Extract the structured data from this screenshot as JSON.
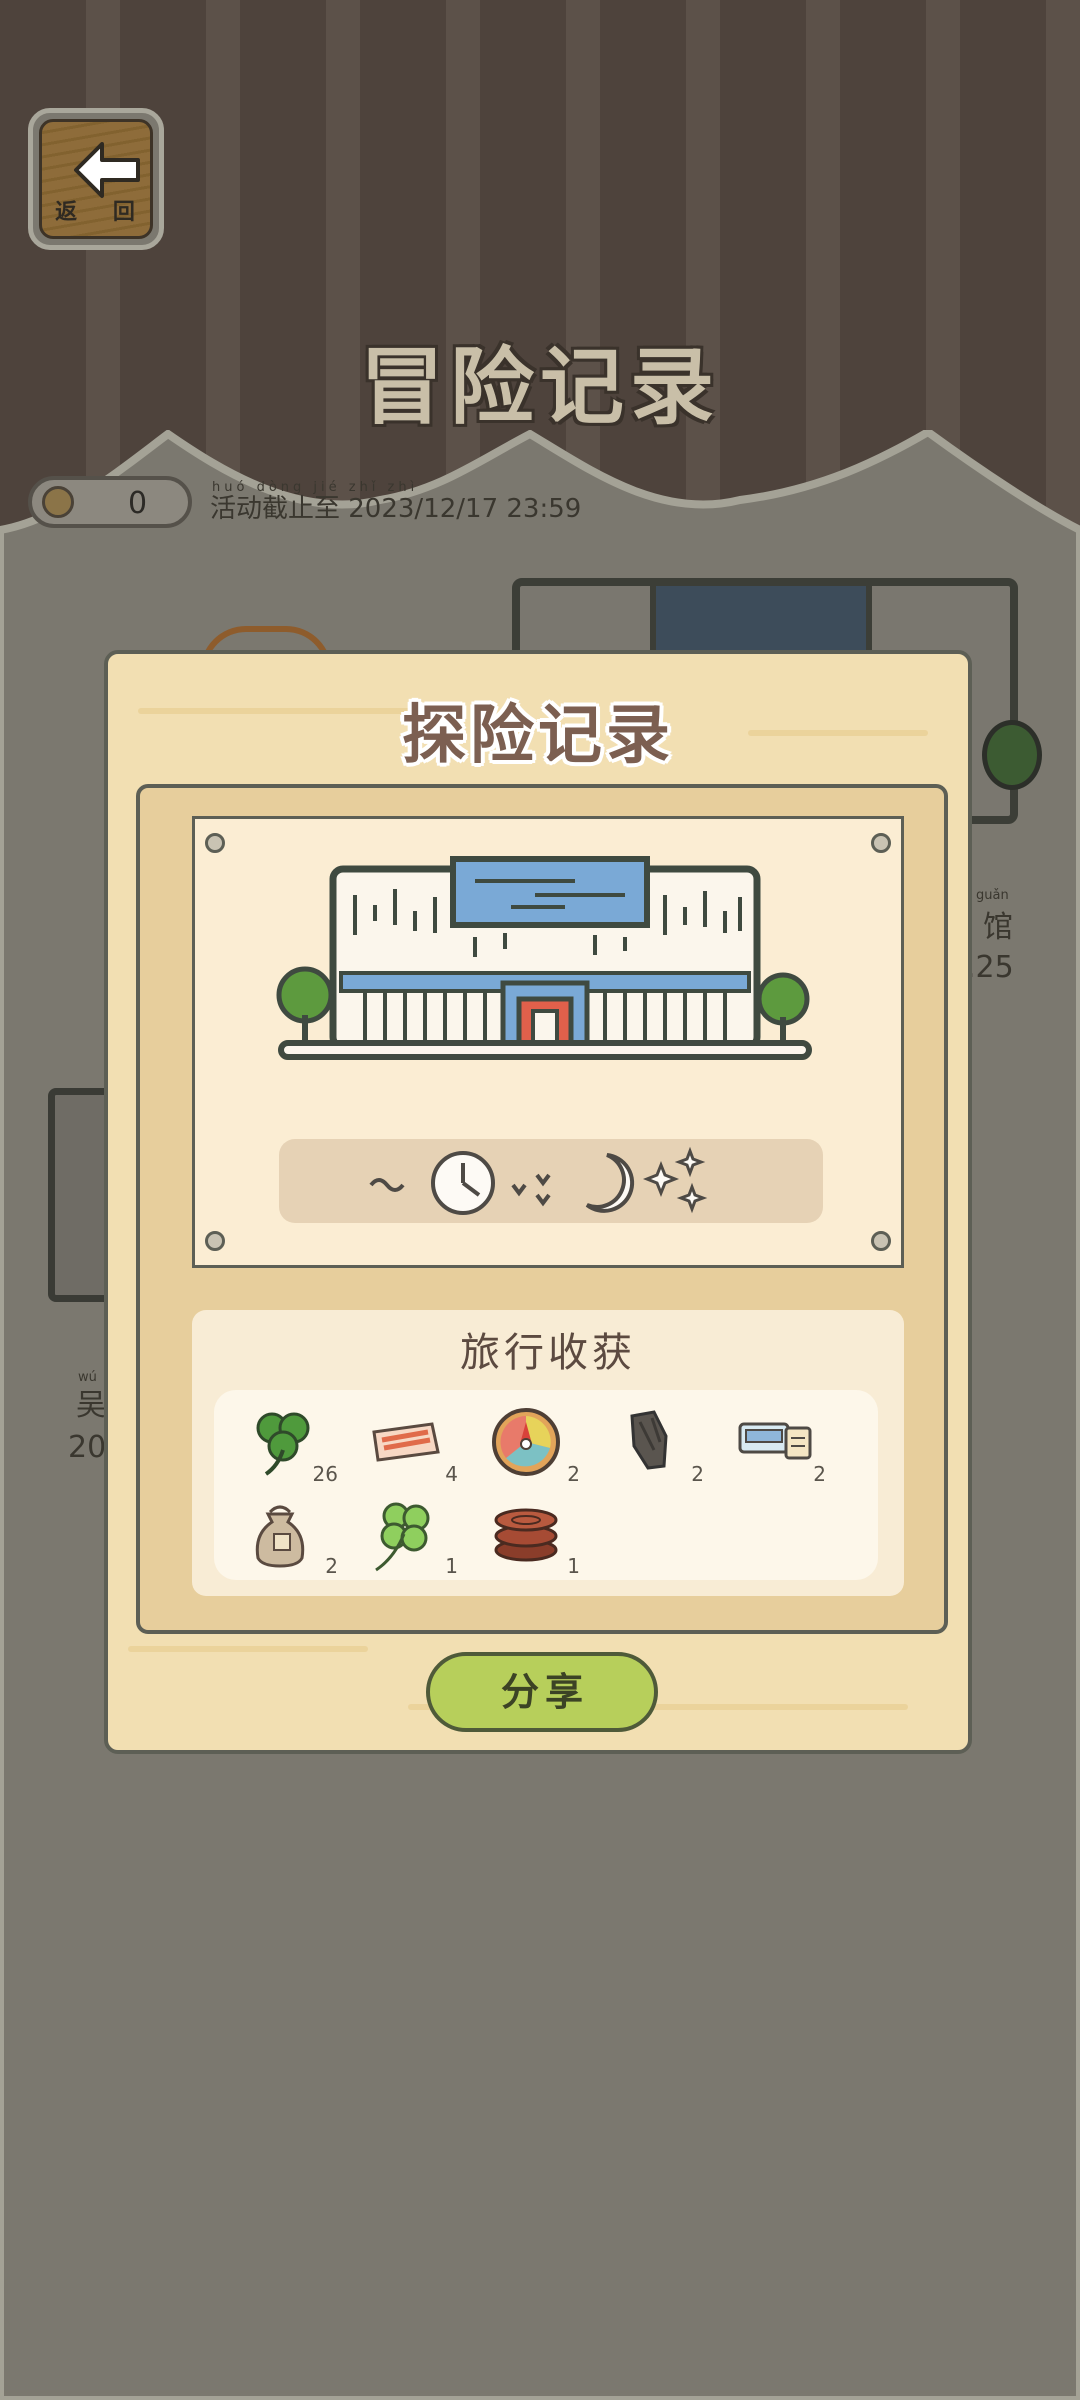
{
  "header": {
    "back_label": "返 回",
    "title": "冒险记录",
    "coin_count": "0",
    "deadline_pinyin": "huó dòng jié zhǐ zhì",
    "deadline_text": "活动截止至 2023/12/17 23:59"
  },
  "background": {
    "right_label_pinyin": "guǎn",
    "right_label": "馆",
    "right_date_fragment": ".25",
    "left_label_pinyin": "wú",
    "left_label": "吴",
    "left_date_fragment": "20"
  },
  "dialog": {
    "title": "探险记录",
    "harvest_title": "旅行收获",
    "share_label": "分享",
    "items": [
      {
        "icon": "clover-icon",
        "count": "26"
      },
      {
        "icon": "meat-slice-icon",
        "count": "4"
      },
      {
        "icon": "compass-icon",
        "count": "2"
      },
      {
        "icon": "charcoal-icon",
        "count": "2"
      },
      {
        "icon": "tickets-icon",
        "count": "2"
      },
      {
        "icon": "seed-bag-icon",
        "count": "2"
      },
      {
        "icon": "four-leaf-clover-icon",
        "count": "1"
      },
      {
        "icon": "wooden-rings-icon",
        "count": "1"
      }
    ]
  },
  "colors": {
    "stripe_dark": "#4e433c",
    "ground": "#7b786f",
    "dialog_bg": "#f2dfb2",
    "share_button": "#b7cf5b"
  }
}
